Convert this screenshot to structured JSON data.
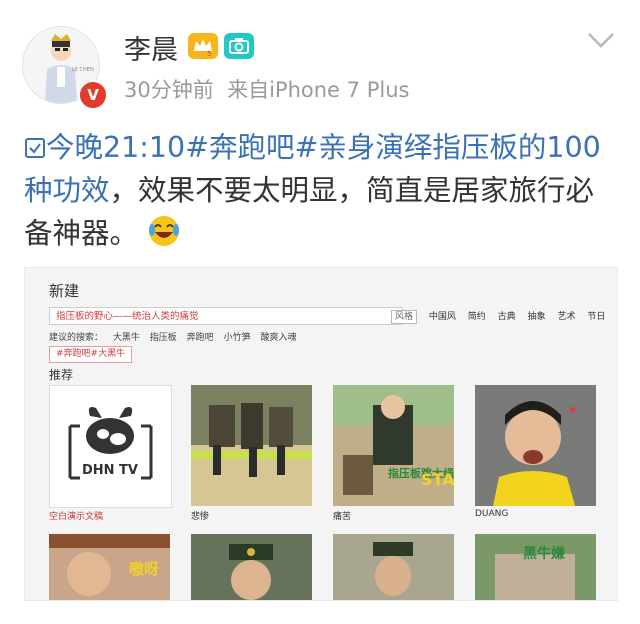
{
  "post": {
    "username": "李晨",
    "avatar_text": "LE CHEN",
    "badges": [
      "crown-badge",
      "camera-badge"
    ],
    "crown_badge_level": "5",
    "verified_mark": "V",
    "time": "30分钟前",
    "source": "来自iPhone 7 Plus",
    "text_parts": {
      "link1": "今晚21:10#奔跑吧#亲身演绎指压板的100种功效",
      "plain": "，效果不要太明显，简直是居家旅行必备神器。"
    },
    "emoji": "laughing-crying-emoji"
  },
  "embed": {
    "title": "新建",
    "search_value": "指压板的野心——统治人类的痛觉",
    "style_filters": [
      "风格",
      "中国风",
      "简约",
      "古典",
      "抽象",
      "艺术",
      "节日"
    ],
    "suggest_label": "建议的搜索：",
    "suggestions": [
      "大黑牛",
      "指压板",
      "奔跑吧",
      "小竹笋",
      "酸爽入魂"
    ],
    "tag": "#奔跑吧#大黑牛",
    "section": "推荐",
    "logo_text": "DHN TV",
    "tiles": [
      {
        "label": "空白演示文稿"
      },
      {
        "label": "悲惨"
      },
      {
        "label": "痛苦",
        "caption": "指压板跳大绳 第一回合",
        "overlay": "STA"
      },
      {
        "label": "DUANG"
      }
    ],
    "bottom_overlays": [
      "嗷呀",
      "黑牛嫌"
    ]
  },
  "colors": {
    "link": "#3b71b5",
    "verified": "#e33a2a",
    "crown": "#f6b51b",
    "camera": "#22c7c7"
  }
}
